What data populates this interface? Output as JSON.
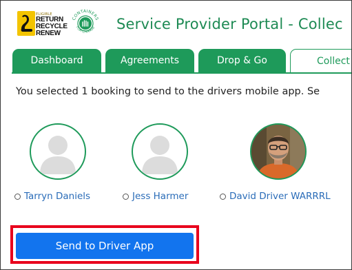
{
  "header": {
    "title": "Service Provider Portal - Collec",
    "logos": {
      "rrr": {
        "small_text": "ELIGIBLE",
        "lines": [
          "RETURN",
          "RECYCLE",
          "RENEW"
        ],
        "icon": "swan-icon"
      },
      "cfc": {
        "top_text": "CONTAINERS",
        "bottom_text": "FOR CHANGE",
        "icon": "recycle-hand-icon"
      }
    }
  },
  "tabs": [
    {
      "label": "Dashboard",
      "active": false
    },
    {
      "label": "Agreements",
      "active": false
    },
    {
      "label": "Drop & Go",
      "active": false
    },
    {
      "label": "Collect",
      "active": true
    }
  ],
  "main": {
    "info_text": "You selected 1 booking to send to the drivers mobile app. Se",
    "drivers": [
      {
        "name": "Tarryn Daniels",
        "avatar": "placeholder-avatar-icon",
        "selected": false
      },
      {
        "name": "Jess Harmer",
        "avatar": "placeholder-avatar-icon",
        "selected": false
      },
      {
        "name": "David Driver WARRRL",
        "avatar": "photo-avatar",
        "selected": false
      }
    ],
    "send_button_label": "Send to Driver App"
  },
  "colors": {
    "brand_green": "#1e9a5a",
    "title_green": "#1e8a54",
    "link_blue": "#2a6cb8",
    "button_blue": "#1274ee",
    "highlight_red": "#e8001c"
  }
}
